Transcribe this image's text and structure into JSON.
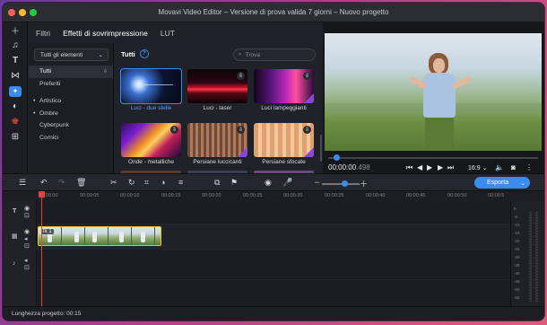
{
  "window": {
    "title": "Movavi Video Editor – Versione di prova valida 7 giorni – Nuovo progetto",
    "traffic_colors": [
      "#fe5f57",
      "#febc2e",
      "#28c840"
    ]
  },
  "left_toolbar": {
    "icons": [
      "plus-icon",
      "music-note-icon",
      "text-icon",
      "transitions-icon",
      "effects-icon",
      "filters-icon",
      "stickers-icon",
      "more-tools-icon"
    ]
  },
  "tabs": [
    {
      "label": "Filtri"
    },
    {
      "label": "Effetti di sovrimpressione"
    },
    {
      "label": "LUT"
    }
  ],
  "categories": {
    "dropdown_label": "Tutti gli elementi",
    "items": [
      {
        "label": "Tutti"
      },
      {
        "label": "Preferiti"
      },
      {
        "label": "Artistico"
      },
      {
        "label": "Ombre"
      },
      {
        "label": "Cyberpunk"
      },
      {
        "label": "Cornici"
      }
    ]
  },
  "gallery": {
    "heading": "Tutti",
    "search_placeholder": "Trova",
    "tiles": [
      {
        "label": "Luci - due stelle"
      },
      {
        "label": "Luci - laser"
      },
      {
        "label": "Luci lampeggianti"
      },
      {
        "label": "Onde - metalliche"
      },
      {
        "label": "Persiane luccicanti"
      },
      {
        "label": "Persiane sfocate"
      }
    ]
  },
  "player": {
    "time_main": "00:00:00",
    "time_ms": ".498",
    "aspect": "16:9",
    "progress": 0.03
  },
  "timeline": {
    "export_label": "Esporta",
    "ticks": [
      "00:00:00",
      "00:00:05",
      "00:00:10",
      "00:00:15",
      "00:00:20",
      "00:00:25",
      "00:00:30",
      "00:00:35",
      "00:00:40",
      "00:00:45",
      "00:00:50",
      "00:00:5"
    ],
    "clip_badge": "fx 1",
    "meter_labels": [
      "0",
      "-5",
      "-10",
      "-15",
      "-20",
      "-25",
      "-30",
      "-35",
      "-40",
      "-45",
      "-50",
      "-55"
    ]
  },
  "status": {
    "project_length": "Lunghezza progetto: 00:15"
  },
  "accent_color": "#3c8cf0"
}
